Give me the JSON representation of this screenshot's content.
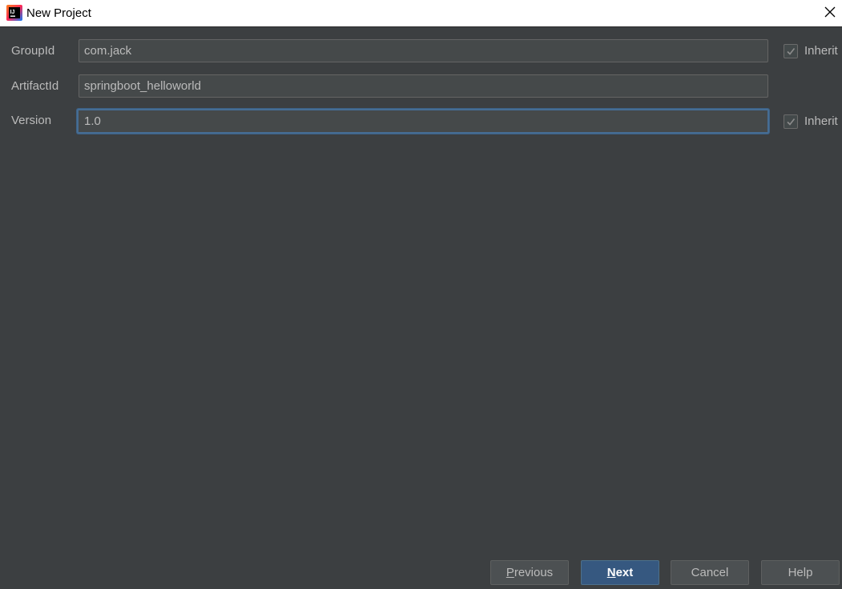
{
  "window": {
    "title": "New Project"
  },
  "form": {
    "group_id": {
      "label": "GroupId",
      "value": "com.jack",
      "inherit_label": "Inherit",
      "inherit_checked": true
    },
    "artifact_id": {
      "label": "ArtifactId",
      "value": "springboot_helloworld"
    },
    "version": {
      "label": "Version",
      "value": "1.0",
      "inherit_label": "Inherit",
      "inherit_checked": true
    }
  },
  "buttons": {
    "previous": {
      "mnemonic": "P",
      "rest": "revious"
    },
    "next": {
      "mnemonic": "N",
      "rest": "ext"
    },
    "cancel": "Cancel",
    "help": "Help"
  },
  "colors": {
    "background": "#3c3f41",
    "input_bg": "#45494a",
    "text": "#bbbbbb",
    "primary_button": "#365880",
    "focus_border": "#466d94"
  },
  "icons": {
    "app": "intellij-idea-icon",
    "close": "close-icon",
    "check": "checkmark-icon"
  }
}
